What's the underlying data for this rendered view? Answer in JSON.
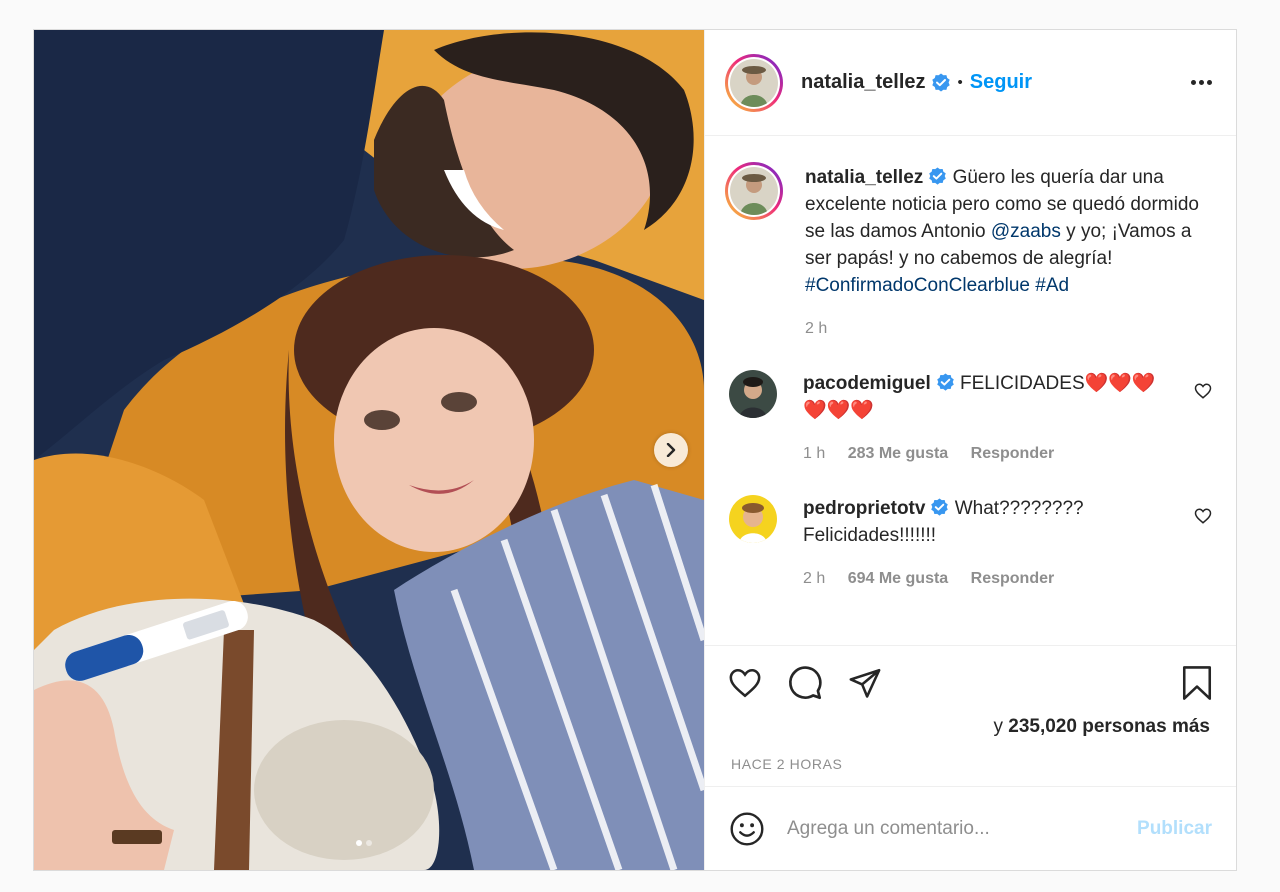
{
  "post": {
    "image_alt": "Foto de pareja con perro y prueba de embarazo",
    "carousel_count": 2,
    "carousel_active_index": 0
  },
  "header": {
    "username": "natalia_tellez",
    "bullet": "•",
    "follow_label": "Seguir"
  },
  "caption": {
    "username": "natalia_tellez",
    "text_1": "Güero les quería dar una excelente noticia pero como se quedó dormido se las damos Antonio ",
    "mention": "@zaabs",
    "text_2": " y yo; ¡Vamos a ser papás! y no cabemos de alegría! ",
    "hashtag_1": "#ConfirmadoConClearblue",
    "hashtag_2": "#Ad",
    "time": "2 h"
  },
  "comments": [
    {
      "username": "pacodemiguel",
      "text": "FELICIDADES❤️❤️❤️❤️❤️❤️",
      "time": "1 h",
      "likes": "283 Me gusta",
      "reply": "Responder"
    },
    {
      "username": "pedroprietotv",
      "text": "What???????? Felicidades!!!!!!!",
      "time": "2 h",
      "likes": "694 Me gusta",
      "reply": "Responder"
    }
  ],
  "likes": {
    "prefix": "y ",
    "count_text": "235,020 personas más"
  },
  "timestamp": "HACE 2 HORAS",
  "add_comment": {
    "placeholder": "Agrega un comentario...",
    "publish_label": "Publicar"
  },
  "colors": {
    "accent": "#0095f6",
    "verified": "#3897f0",
    "link": "#00376b",
    "muted": "#8e8e8e",
    "publish_disabled": "#b2dffc"
  }
}
